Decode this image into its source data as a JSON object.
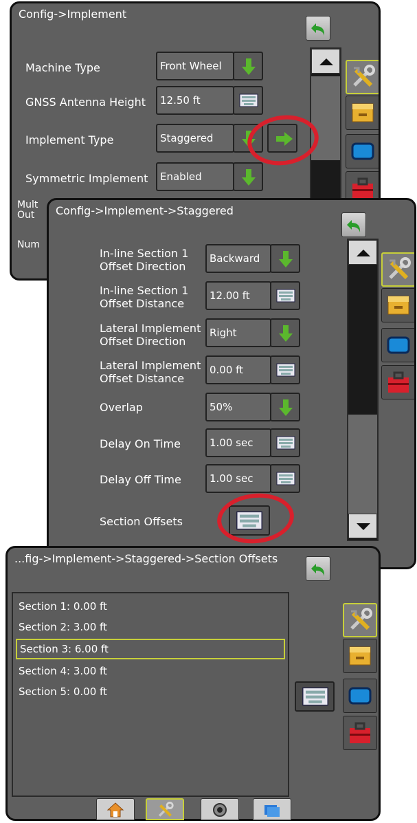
{
  "panel1": {
    "title": "Config->Implement",
    "rows": [
      {
        "label": "Machine Type",
        "value": "Front Wheel",
        "control": "dropdown"
      },
      {
        "label": "GNSS Antenna Height",
        "value": "12.50 ft",
        "control": "keyboard"
      },
      {
        "label": "Implement Type",
        "value": "Staggered",
        "control": "dropdown"
      },
      {
        "label": "Symmetric Implement",
        "value": "Enabled",
        "control": "dropdown"
      },
      {
        "label": "Mult",
        "label2": "Out",
        "value": "",
        "control": "none"
      },
      {
        "label": "Num",
        "value": "",
        "control": "none"
      }
    ]
  },
  "panel2": {
    "title": "Config->Implement->Staggered",
    "rows": [
      {
        "label": "In-line Section 1",
        "label2": "Offset Direction",
        "value": "Backward",
        "control": "dropdown"
      },
      {
        "label": "In-line Section 1",
        "label2": "Offset Distance",
        "value": "12.00 ft",
        "control": "keyboard"
      },
      {
        "label": "Lateral Implement",
        "label2": "Offset Direction",
        "value": "Right",
        "control": "dropdown"
      },
      {
        "label": "Lateral Implement",
        "label2": "Offset Distance",
        "value": "0.00 ft",
        "control": "keyboard"
      },
      {
        "label": "Overlap",
        "value": "50%",
        "control": "dropdown"
      },
      {
        "label": "Delay On Time",
        "value": "1.00 sec",
        "control": "keyboard"
      },
      {
        "label": "Delay Off Time",
        "value": "1.00 sec",
        "control": "keyboard"
      },
      {
        "label": "Section Offsets",
        "value": "",
        "control": "keyboard-large"
      }
    ]
  },
  "panel3": {
    "title": "...fig->Implement->Staggered->Section Offsets",
    "items": [
      {
        "label": "Section 1: 0.00 ft",
        "selected": false
      },
      {
        "label": "Section 2: 3.00 ft",
        "selected": false
      },
      {
        "label": "Section 3: 6.00 ft",
        "selected": true
      },
      {
        "label": "Section 4: 3.00 ft",
        "selected": false
      },
      {
        "label": "Section 5: 0.00 ft",
        "selected": false
      }
    ],
    "bottom_tabs": [
      {
        "name": "home-icon",
        "active": false
      },
      {
        "name": "tools-icon",
        "active": true
      },
      {
        "name": "gauge-icon",
        "active": false
      },
      {
        "name": "folders-icon",
        "active": false
      }
    ]
  },
  "side_tabs": [
    "tools-icon",
    "console-icon",
    "screen-icon",
    "toolbox-icon"
  ],
  "colors": {
    "panel_bg": "#5f5f5f",
    "accent_green": "#5bb82d",
    "selection_outline": "#c7cf3a",
    "highlight_circle": "#d8202c"
  }
}
